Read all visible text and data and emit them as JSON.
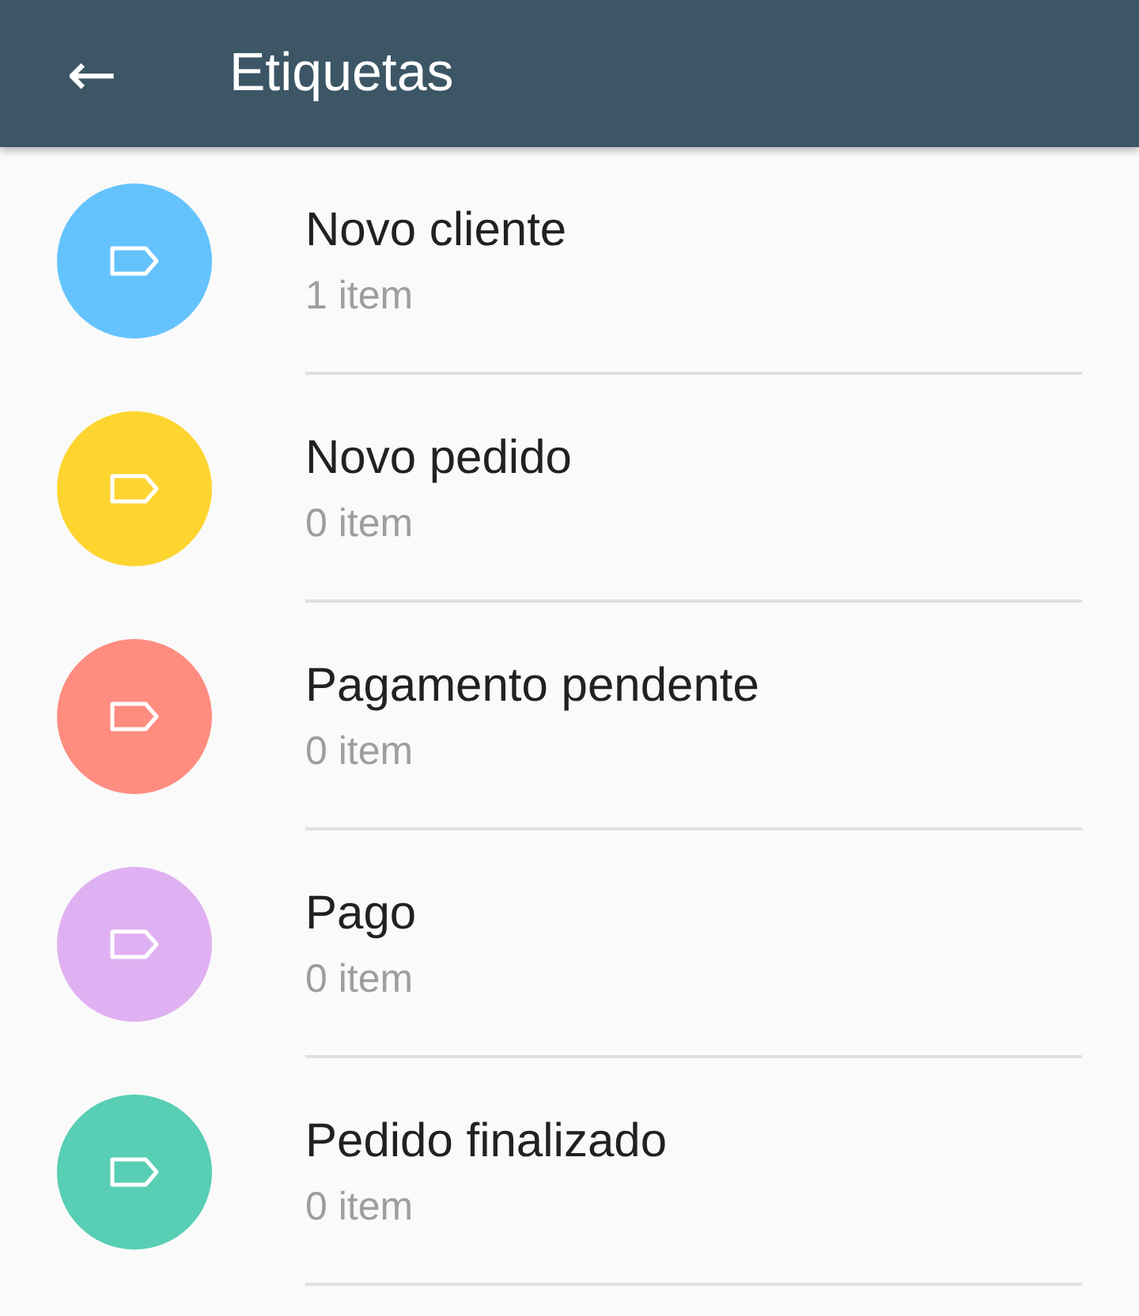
{
  "app_bar": {
    "back_icon": "←",
    "title": "Etiquetas"
  },
  "labels": [
    {
      "name": "Novo cliente",
      "count": "1 item",
      "color": "#64c3fd"
    },
    {
      "name": "Novo pedido",
      "count": "0 item",
      "color": "#fed52f"
    },
    {
      "name": "Pagamento pendente",
      "count": "0 item",
      "color": "#fe8c7f"
    },
    {
      "name": "Pago",
      "count": "0 item",
      "color": "#e0b1f2"
    },
    {
      "name": "Pedido finalizado",
      "count": "0 item",
      "color": "#58ceb4"
    }
  ]
}
